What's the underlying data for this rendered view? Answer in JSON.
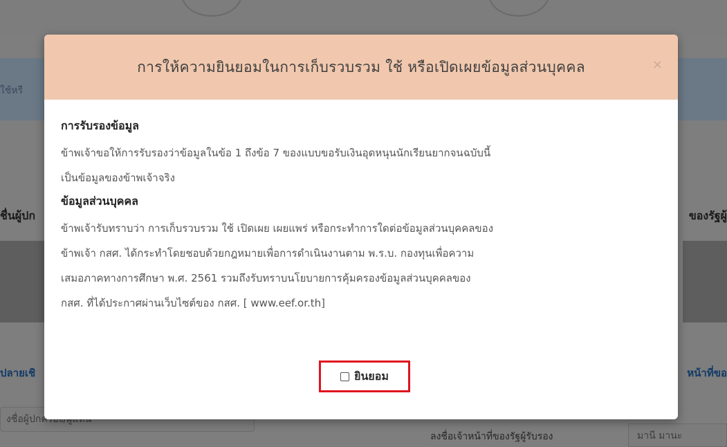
{
  "background": {
    "band_text": "ใช้หรื",
    "left_label": "ชื่นผู้ปก",
    "right_label": "ของรัฐผู้",
    "left_link": "ปลายเชิ",
    "right_link": "หน้าที่ขอ",
    "input_placeholder": "งชื่อผู้ปกครอง/ผู้แทน",
    "bottom_label": "ลงชื่อเจ้าหน้าที่ของรัฐผู้รับรอง",
    "bottom_input_value": "มานี มานะ"
  },
  "modal": {
    "title": "การให้ความยินยอมในการเก็บรวบรวม ใช้ หรือเปิดเผยข้อมูลส่วนบุคคล",
    "close_label": "×",
    "section1": {
      "heading": "การรับรองข้อมูล",
      "lines": [
        "ข้าพเจ้าขอให้การรับรองว่าข้อมูลในข้อ 1 ถึงข้อ 7 ของแบบขอรับเงินอุดหนุนนักเรียนยากจนฉบับนี้",
        "เป็นข้อมูลของข้าพเจ้าจริง"
      ]
    },
    "section2": {
      "heading": "ข้อมูลส่วนบุคคล",
      "lines": [
        "ข้าพเจ้ารับทราบว่า การเก็บรวบรวม ใช้ เปิดเผย เผยแพร่ หรือกระทำการใดต่อข้อมูลส่วนบุคคลของ",
        "ข้าพเจ้า กสศ. ได้กระทำโดยชอบด้วยกฎหมายเพื่อการดำเนินงานตาม พ.ร.บ. กองทุนเพื่อความ",
        "เสมอภาคทางการศึกษา พ.ศ. 2561 รวมถึงรับทราบนโยบายการคุ้มครองข้อมูลส่วนบุคคลของ",
        "กสศ. ที่ได้ประกาศผ่านเว็บไซต์ของ กสศ. [ www.eef.or.th]"
      ]
    },
    "consent_label": "ยินยอม",
    "consent_checked": false
  },
  "colors": {
    "header_bg": "#f1c8ae",
    "highlight_border": "#e0141f"
  }
}
